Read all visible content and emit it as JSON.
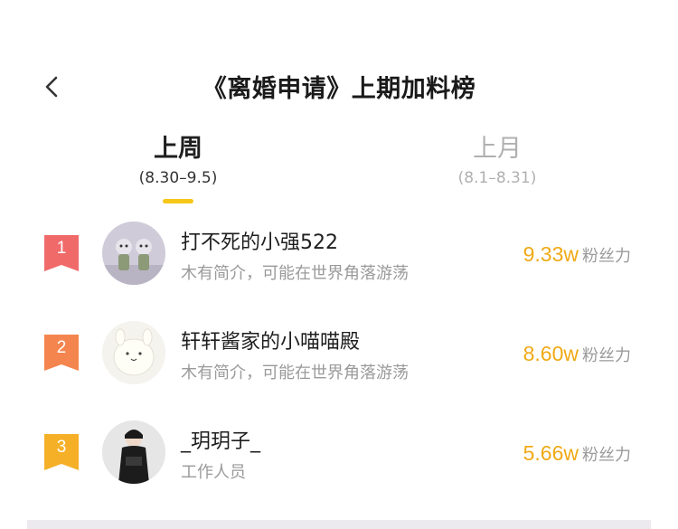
{
  "header": {
    "title": "《离婚申请》上期加料榜",
    "back_icon": "chevron-left-icon"
  },
  "tabs": [
    {
      "label": "上周",
      "sub": "(8.30–9.5)",
      "active": true
    },
    {
      "label": "上月",
      "sub": "(8.1–8.31)",
      "active": false
    }
  ],
  "colors": {
    "accent": "#f6c619",
    "score": "#f0a915",
    "rank1": "#f06a6a",
    "rank2": "#f5854e",
    "rank3": "#f5b028"
  },
  "ranking": [
    {
      "rank": "1",
      "name": "打不死的小强522",
      "bio": "木有简介，可能在世界角落游荡",
      "score": "9.33w",
      "unit": "粉丝力"
    },
    {
      "rank": "2",
      "name": "轩轩酱家的小喵喵殿",
      "bio": "木有简介，可能在世界角落游荡",
      "score": "8.60w",
      "unit": "粉丝力"
    },
    {
      "rank": "3",
      "name": "_玥玥子_",
      "bio": "工作人员",
      "score": "5.66w",
      "unit": "粉丝力"
    }
  ]
}
